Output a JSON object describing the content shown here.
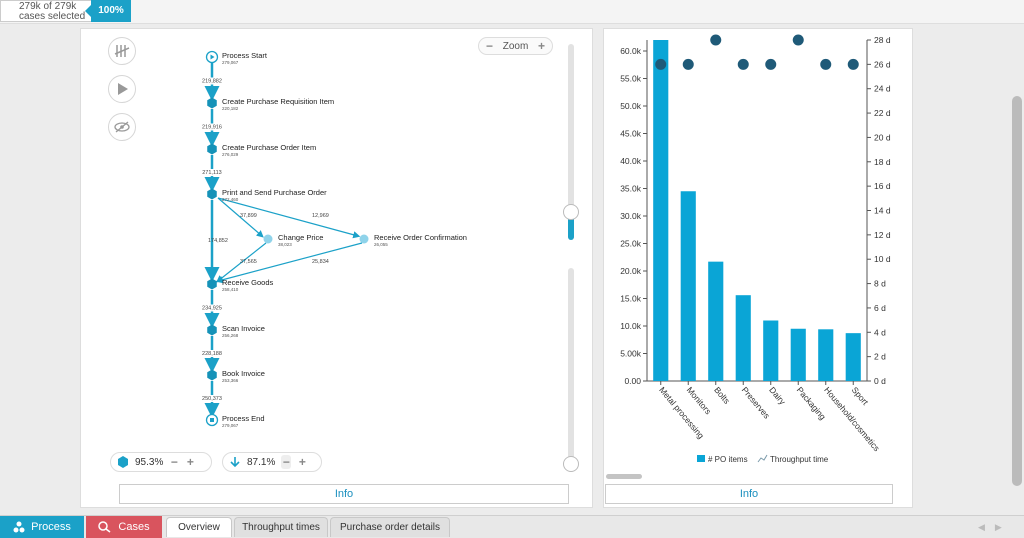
{
  "selection": {
    "line1": "279k of 279k",
    "line2": "cases selected",
    "percent": "100%"
  },
  "zoom": {
    "label": "Zoom",
    "minus": "−",
    "plus": "+"
  },
  "process_map": {
    "nodes": [
      {
        "id": "start",
        "label": "Process Start",
        "count": "279,067"
      },
      {
        "id": "cpri",
        "label": "Create Purchase Requisition Item",
        "count": "220,182"
      },
      {
        "id": "cpoi",
        "label": "Create Purchase Order Item",
        "count": "276,029"
      },
      {
        "id": "pspo",
        "label": "Print and Send Purchase Order",
        "count": "272,460"
      },
      {
        "id": "cp",
        "label": "Change Price",
        "count": "38,023"
      },
      {
        "id": "roc",
        "label": "Receive Order Confirmation",
        "count": "26,055"
      },
      {
        "id": "rg",
        "label": "Receive Goods",
        "count": "258,410"
      },
      {
        "id": "si",
        "label": "Scan Invoice",
        "count": "256,268"
      },
      {
        "id": "bi",
        "label": "Book Invoice",
        "count": "253,366"
      },
      {
        "id": "end",
        "label": "Process End",
        "count": "279,067"
      }
    ],
    "edges": [
      {
        "from": "start",
        "to": "cpri",
        "label": "219,882"
      },
      {
        "from": "cpri",
        "to": "cpoi",
        "label": "219,916"
      },
      {
        "from": "cpoi",
        "to": "pspo",
        "label": "271,113"
      },
      {
        "from": "pspo",
        "to": "cp",
        "label": "37,899"
      },
      {
        "from": "pspo",
        "to": "roc",
        "label": "12,969"
      },
      {
        "from": "pspo",
        "to": "rg",
        "label": "174,852"
      },
      {
        "from": "cp",
        "to": "rg",
        "label": "37,565"
      },
      {
        "from": "roc",
        "to": "rg",
        "label": "25,834"
      },
      {
        "from": "rg",
        "to": "si",
        "label": "234,925"
      },
      {
        "from": "si",
        "to": "bi",
        "label": "228,188"
      },
      {
        "from": "bi",
        "to": "end",
        "label": "250,373"
      }
    ]
  },
  "activities_pill": {
    "value": "95.3%",
    "minus": "−",
    "plus": "+"
  },
  "connections_pill": {
    "value": "87.1%",
    "minus": "−",
    "plus": "+"
  },
  "info_left": "Info",
  "info_right": "Info",
  "chart_data": {
    "type": "bar",
    "categories": [
      "Metal processing",
      "Monitors",
      "Bolts",
      "Preserves",
      "Dairy",
      "Packaging",
      "Household/cosmetics",
      "Sport"
    ],
    "series": [
      {
        "name": "# PO items",
        "type": "bar",
        "axis": "left",
        "values": [
          62000,
          34500,
          21700,
          15600,
          11000,
          9500,
          9400,
          8700
        ]
      },
      {
        "name": "Throughput time",
        "type": "scatter",
        "axis": "right",
        "values": [
          26,
          26,
          28,
          26,
          26,
          28,
          26,
          26
        ]
      }
    ],
    "y_left": {
      "ylim": [
        0,
        62000
      ],
      "ticks": [
        0,
        5000,
        10000,
        15000,
        20000,
        25000,
        30000,
        35000,
        40000,
        45000,
        50000,
        55000,
        60000
      ],
      "tick_labels": [
        "0.00",
        "5.00k",
        "10.0k",
        "15.0k",
        "20.0k",
        "25.0k",
        "30.0k",
        "35.0k",
        "40.0k",
        "45.0k",
        "50.0k",
        "55.0k",
        "60.0k"
      ]
    },
    "y_right": {
      "ylim": [
        0,
        28
      ],
      "ticks": [
        0,
        2,
        4,
        6,
        8,
        10,
        12,
        14,
        16,
        18,
        20,
        22,
        24,
        26,
        28
      ],
      "tick_labels": [
        "0 d",
        "2 d",
        "4 d",
        "6 d",
        "8 d",
        "10 d",
        "12 d",
        "14 d",
        "16 d",
        "18 d",
        "20 d",
        "22 d",
        "24 d",
        "26 d",
        "28 d"
      ]
    },
    "legend": [
      "# PO items",
      "Throughput time"
    ],
    "legend_position": "bottom",
    "colors": {
      "bar": "#0aa5d6",
      "dot": "#1f5a78"
    }
  },
  "tabs": {
    "process": "Process",
    "cases": "Cases",
    "subtabs": [
      "Overview",
      "Throughput times",
      "Purchase order details"
    ]
  },
  "icons": [
    "tally-icon",
    "play-icon",
    "hide-icon",
    "hexagon-icon",
    "arrow-down-icon",
    "process-icon",
    "cases-icon"
  ]
}
